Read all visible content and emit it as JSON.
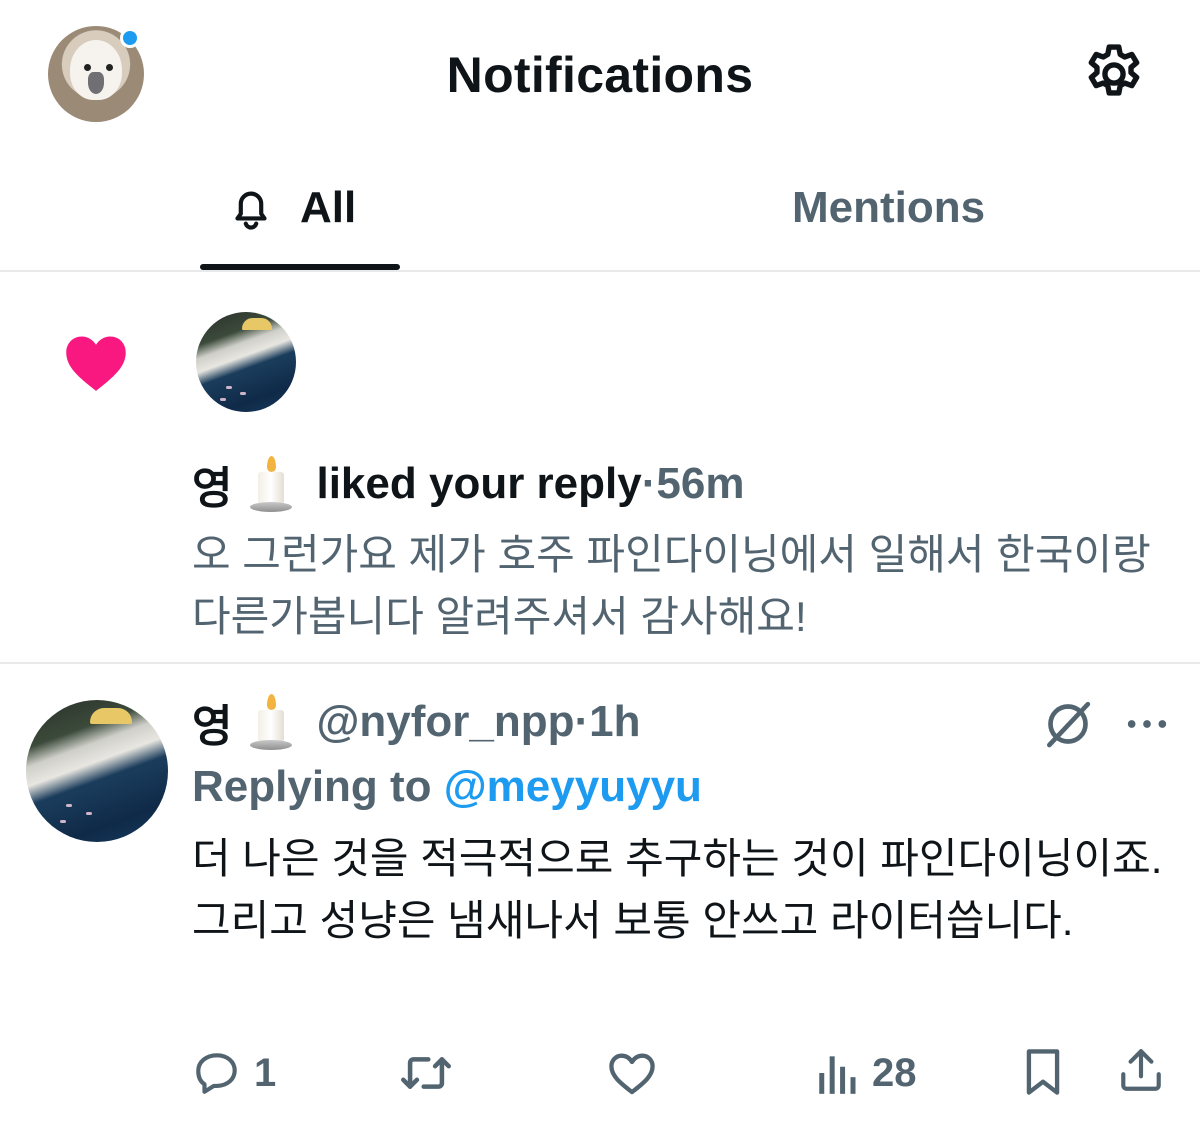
{
  "header": {
    "title": "Notifications",
    "avatar_icon": "profile-avatar-cockatoo",
    "settings_icon": "gear-icon",
    "unread_dot_color": "#1d9bf0"
  },
  "tabs": [
    {
      "label": "All",
      "active": true,
      "icon": "bell-icon"
    },
    {
      "label": "Mentions",
      "active": false
    }
  ],
  "notification": {
    "type_icon": "heart-icon",
    "type_color": "#f91880",
    "user_name": "영",
    "action_text": "liked your reply",
    "separator": " · ",
    "time": "56m",
    "reply_text": "오 그런가요 제가 호주 파인다이닝에서 일해서 한국이랑 다른가봅니다 알려주셔서 감사해요!"
  },
  "tweet": {
    "user_name": "영",
    "handle": "@nyfor_npp",
    "separator": "·",
    "time": "1h",
    "replying_prefix": "Replying to ",
    "replying_to": "@meyyuyyu",
    "body": "더 나은 것을 적극적으로 추구하는 것이 파인다이닝이죠. 그리고 성냥은 냄새나서 보통 안쓰고 라이터씁니다.",
    "reply_count": "1",
    "retweet_count": "",
    "like_count": "",
    "view_count": "28",
    "accent_color": "#1d9bf0"
  }
}
